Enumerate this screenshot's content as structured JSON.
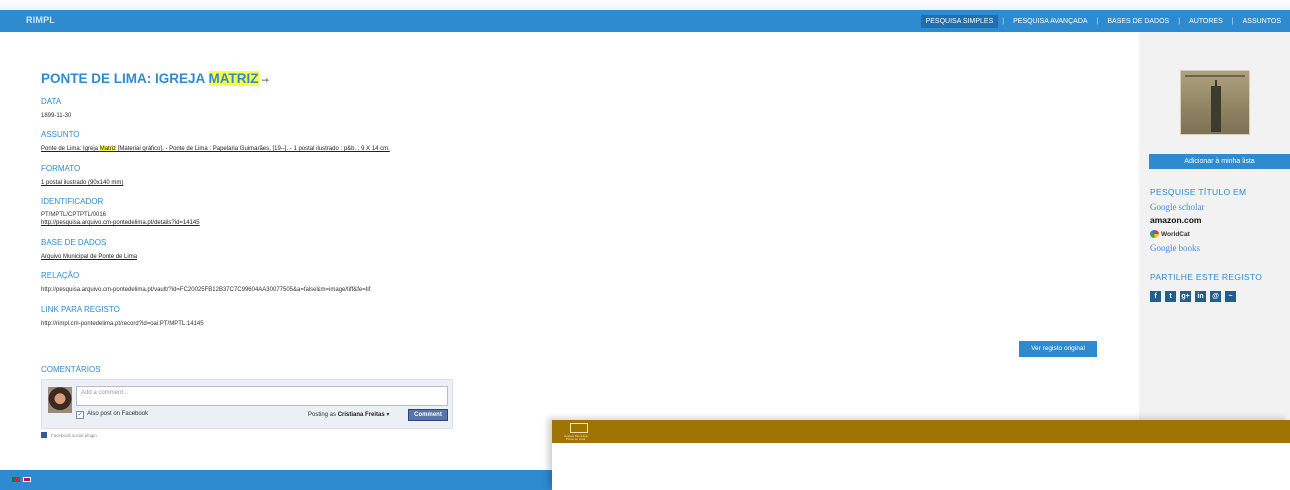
{
  "header": {
    "logo": "RIMPL",
    "nav": [
      {
        "label": "PESQUISA SIMPLES",
        "active": true
      },
      {
        "label": "PESQUISA AVANÇADA",
        "active": false
      },
      {
        "label": "BASES DE DADOS",
        "active": false
      },
      {
        "label": "AUTORES",
        "active": false
      },
      {
        "label": "ASSUNTOS",
        "active": false
      }
    ]
  },
  "record": {
    "title_prefix": "PONTE DE LIMA: IGREJA ",
    "title_highlight": "MATRIZ",
    "fields": {
      "data_label": "DATA",
      "data_value": "1899-11-30",
      "assunto_label": "ASSUNTO",
      "assunto_prefix": "Ponte de Lima: Igreja ",
      "assunto_highlight": "Matriz",
      "assunto_suffix": " [Material gráfico]. - Ponte de Lima : Papelaria Guimarães, [19--]. - 1 postal ilustrado : p&b. ; 9 X 14 cm.",
      "formato_label": "FORMATO",
      "formato_value": "1 postal ilustrado (90x140 mm)",
      "identificador_label": "IDENTIFICADOR",
      "identificador_value1": "PT/MPTL/CPTPTL/0016",
      "identificador_value2": "http://pesquisa.arquivo.cm-pontedelima.pt/details?id=14145",
      "base_label": "BASE DE DADOS",
      "base_value": "Arquivo Municipal de Ponte de Lima",
      "relacao_label": "RELAÇÃO",
      "relacao_value": "http://pesquisa.arquivo.cm-pontedelima.pt/vault/?id=FC20025FB12B37C7C99604AA30077505&a=false&m=image/tiff&fe=tif",
      "link_label": "LINK PARA REGISTO",
      "link_value": "http://rimpl.cm-pontedelima.pt/record?id=oai:PT/MPTL:14145"
    },
    "original_button": "Ver registo original"
  },
  "comments": {
    "label": "COMENTÁRIOS",
    "placeholder": "Add a comment...",
    "also_post": "Also post on Facebook",
    "posting_as_prefix": "Posting as ",
    "posting_as_name": "Cristiana Freitas",
    "posting_as_caret": "▾",
    "comment_button": "Comment",
    "plugin_note": "Facebook social plugin"
  },
  "sidebar": {
    "add_button": "Adicionar à minha lista",
    "search_title": "PESQUISE TÍTULO EM",
    "links": {
      "google_scholar_1": "Google",
      "google_scholar_2": "scholar",
      "amazon": "amazon.com",
      "worldcat": "WorldCat",
      "google_books_1": "Google",
      "google_books_2": "books"
    },
    "share_title": "PARTILHE ESTE REGISTO",
    "share_icons": [
      "facebook-icon",
      "twitter-icon",
      "google-plus-icon",
      "linkedin-icon",
      "email-icon",
      "rss-icon"
    ],
    "share_glyphs": [
      "f",
      "t",
      "g+",
      "in",
      "@",
      "~"
    ]
  },
  "overlay": {
    "logo_line1": "Arquivo Municipal",
    "logo_line2": "Ponte de Lima"
  },
  "colors": {
    "accent": "#2e8bd0",
    "highlight": "#ffff40",
    "overlay_bar": "#a07400"
  }
}
